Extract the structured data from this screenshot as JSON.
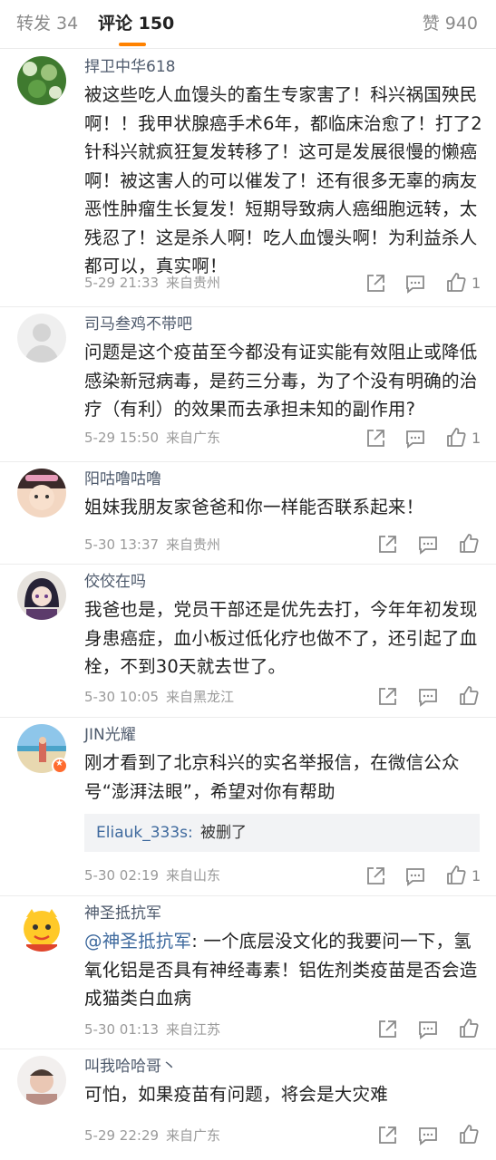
{
  "tabs": {
    "repost": "转发 34",
    "comments": "评论 150",
    "likes": "赞 940"
  },
  "comments": [
    {
      "user": "捍卫中华618",
      "text": "被这些吃人血馒头的畜生专家害了！科兴祸国殃民啊！！我甲状腺癌手术6年，都临床治愈了！打了2针科兴就疯狂复发转移了！这可是发展很慢的懒癌啊！被这害人的可以催发了！还有很多无辜的病友恶性肿瘤生长复发！短期导致病人癌细胞远转，太残忍了！这是杀人啊！吃人血馒头啊！为利益杀人都可以，真实啊！",
      "time": "5-29 21:33",
      "location": "来自贵州",
      "likes": "1"
    },
    {
      "user": "司马叁鸡不带吧",
      "text": "问题是这个疫苗至今都没有证实能有效阻止或降低感染新冠病毒，是药三分毒，为了个没有明确的治疗（有利）的效果而去承担未知的副作用?",
      "time": "5-29 15:50",
      "location": "来自广东",
      "likes": "1"
    },
    {
      "user": "阳咕噜咕噜",
      "text": "姐妹我朋友家爸爸和你一样能否联系起来！",
      "time": "5-30 13:37",
      "location": "来自贵州",
      "likes": ""
    },
    {
      "user": "佼佼在吗",
      "text": "我爸也是，党员干部还是优先去打，今年年初发现身患癌症，血小板过低化疗也做不了，还引起了血栓，不到30天就去世了。",
      "time": "5-30 10:05",
      "location": "来自黑龙江",
      "likes": ""
    },
    {
      "user": "JIN光耀",
      "text": "刚才看到了北京科兴的实名举报信，在微信公众号“澎湃法眼”，希望对你有帮助",
      "reply_user": "Eliauk_333s:",
      "reply_text": "被删了",
      "time": "5-30 02:19",
      "location": "来自山东",
      "likes": "1"
    },
    {
      "user": "神圣抵抗军",
      "mention": "@神圣抵抗军",
      "text": ": 一个底层没文化的我要问一下，氢氧化铝是否具有神经毒素！铝佐剂类疫苗是否会造成猫类白血病",
      "time": "5-30 01:13",
      "location": "来自江苏",
      "likes": ""
    },
    {
      "user": "叫我哈哈哥丶",
      "text": "可怕，如果疫苗有问题，将会是大灾难",
      "time": "5-29 22:29",
      "location": "来自广东",
      "likes": ""
    }
  ],
  "icons": {
    "share": "share-icon",
    "comment": "comment-icon",
    "like": "thumbs-up-icon",
    "badge": "verified-badge-icon"
  },
  "colors": {
    "accent": "#ff8200",
    "link": "#3f6a9e",
    "username": "#4e5a6c",
    "meta": "#9a9a9a"
  }
}
